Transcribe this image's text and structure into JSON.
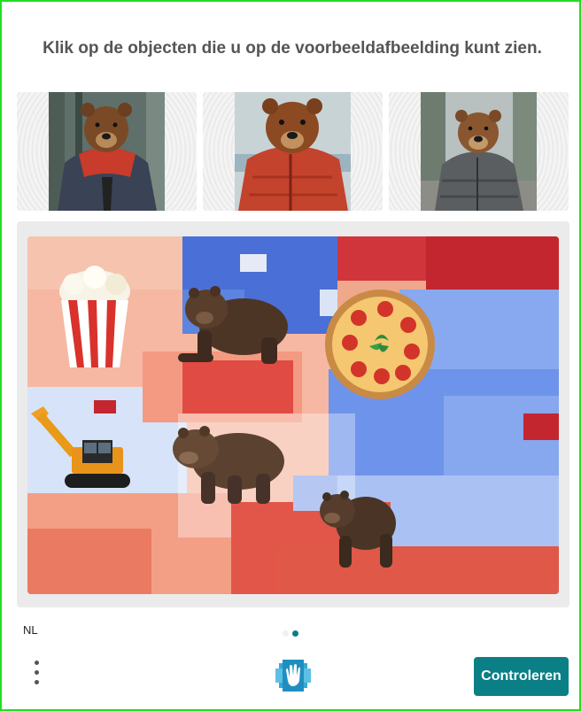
{
  "prompt": "Klik op de objecten die u op de voorbeeldafbeelding kunt zien.",
  "examples": [
    {
      "label": "bear in red hooded jacket"
    },
    {
      "label": "bear in orange puffer jacket"
    },
    {
      "label": "bear in grey puffer jacket"
    }
  ],
  "canvas_items": [
    "popcorn",
    "bear",
    "pizza",
    "excavator",
    "bear",
    "bear"
  ],
  "footer": {
    "language": "NL",
    "pager": {
      "total": 2,
      "active": 2
    },
    "menu_icon": "more-vertical-icon",
    "logo_icon": "hand-logo-icon",
    "submit_label": "Controleren"
  },
  "colors": {
    "accent": "#0a7f86",
    "border": "#22dd22"
  }
}
